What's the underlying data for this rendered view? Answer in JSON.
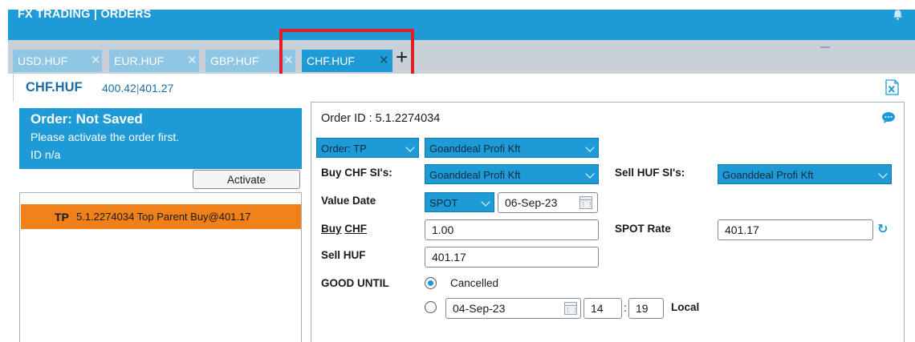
{
  "header": {
    "title": "FX TRADING  |  ORDERS"
  },
  "tabs": [
    {
      "label": "USD.HUF",
      "active": false
    },
    {
      "label": "EUR.HUF",
      "active": false
    },
    {
      "label": "GBP.HUF",
      "active": false
    },
    {
      "label": "CHF.HUF",
      "active": true
    }
  ],
  "quote": {
    "pair": "CHF.HUF",
    "bid": "400.42",
    "ask": "401.27"
  },
  "order_status": {
    "title": "Order: Not Saved",
    "message": "Please activate the order first.",
    "id": "ID n/a",
    "activate_label": "Activate"
  },
  "order_list": [
    {
      "tag": "TP",
      "text": "5.1.2274034 Top Parent Buy@401.17"
    }
  ],
  "form": {
    "order_id": "Order ID : 5.1.2274034",
    "order_type": "Order: TP",
    "counterparty": "Goanddeal Profi Kft",
    "buy_ssi_label": "Buy CHF SI's:",
    "buy_ssi": "Goanddeal Profi Kft",
    "sell_ssi_label": "Sell HUF SI's:",
    "sell_ssi": "Goanddeal Profi Kft",
    "value_date_label": "Value Date",
    "value_date_type": "SPOT",
    "value_date": "06-Sep-23",
    "buy_label": "Buy",
    "buy_ccy": "CHF",
    "buy_amount": "1.00",
    "spot_rate_label": "SPOT Rate",
    "spot_rate": "401.17",
    "sell_label": "Sell HUF",
    "sell_amount": "401.17",
    "good_until_label": "GOOD UNTIL",
    "cancelled_label": "Cancelled",
    "gtd_date": "04-Sep-23",
    "gtd_hour": "14",
    "gtd_minute": "19",
    "local_label": "Local",
    "time_separator": ":"
  },
  "colors": {
    "brand": "#1e9ad6",
    "highlight": "#e41e26",
    "order_item": "#f0801a"
  }
}
